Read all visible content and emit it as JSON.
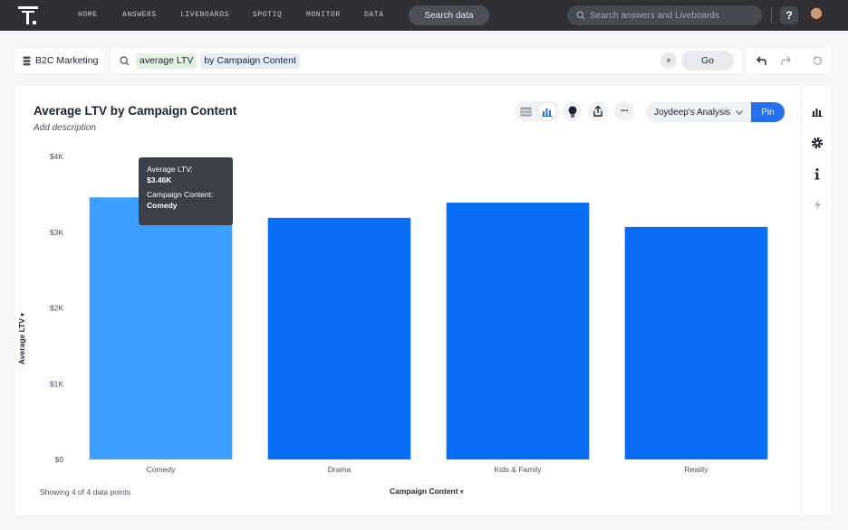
{
  "nav": {
    "items": [
      "HOME",
      "ANSWERS",
      "LIVEBOARDS",
      "SPOTIQ",
      "MONITOR",
      "DATA"
    ],
    "search_data_label": "Search data",
    "global_search_placeholder": "Search answers and Liveboards",
    "help_label": "?"
  },
  "search": {
    "source_label": "B2C Marketing",
    "tokens": [
      "average LTV",
      "by Campaign Content"
    ],
    "clear_label": "×",
    "go_label": "Go"
  },
  "answer": {
    "title": "Average LTV by Campaign Content",
    "description": "Add description",
    "analysis_label": "Joydeep's Analysis",
    "pin_label": "Pin",
    "more_label": "···",
    "data_points_text": "Showing 4 of 4 data points"
  },
  "tooltip": {
    "measure_label": "Average LTV:",
    "measure_value": "$3.46K",
    "attr_label": "Campaign Content:",
    "attr_value": "Comedy"
  },
  "colors": {
    "bar": "#0a6ef5",
    "bar_hover": "#3ba0ff",
    "nav_bg": "#2e3036",
    "pin": "#2770ef"
  },
  "chart_data": {
    "type": "bar",
    "categories": [
      "Comedy",
      "Drama",
      "Kids & Family",
      "Reality"
    ],
    "values": [
      3460,
      3190,
      3390,
      3070
    ],
    "xlabel": "Campaign Content",
    "ylabel": "Average LTV",
    "ylim": [
      0,
      4000
    ],
    "yticks": [
      0,
      1000,
      2000,
      3000,
      4000
    ],
    "ytick_labels": [
      "$0",
      "$1K",
      "$2K",
      "$3K",
      "$4K"
    ],
    "highlighted_category": "Comedy",
    "grid": false
  }
}
